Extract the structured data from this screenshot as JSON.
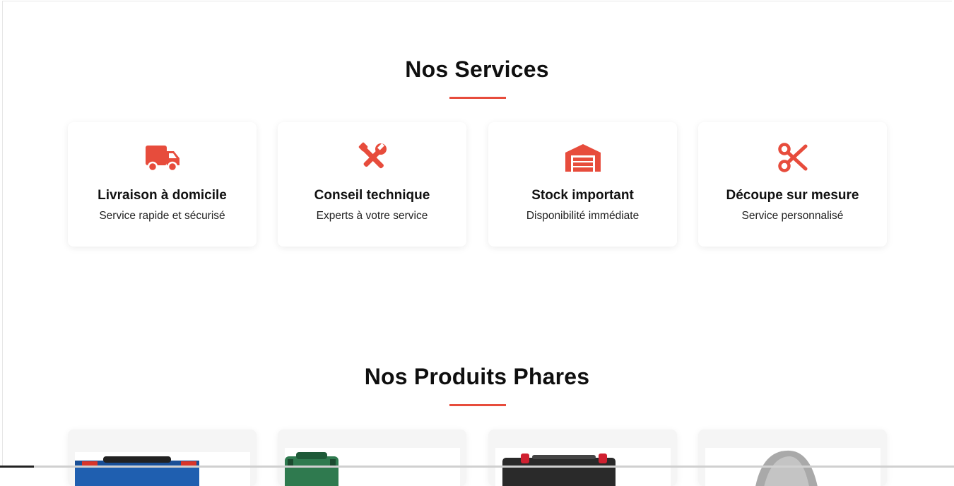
{
  "services_section": {
    "title": "Nos Services",
    "accent_color": "#e74c3c",
    "cards": [
      {
        "icon": "truck-icon",
        "title": "Livraison à domicile",
        "description": "Service rapide et sécurisé"
      },
      {
        "icon": "tools-icon",
        "title": "Conseil technique",
        "description": "Experts à votre service"
      },
      {
        "icon": "warehouse-icon",
        "title": "Stock important",
        "description": "Disponibilité immédiate"
      },
      {
        "icon": "scissors-icon",
        "title": "Découpe sur mesure",
        "description": "Service personnalisé"
      }
    ]
  },
  "products_section": {
    "title": "Nos Produits Phares",
    "cards": [
      {
        "image": "blue-tool-case-image"
      },
      {
        "image": "green-tool-case-image"
      },
      {
        "image": "red-black-tool-image"
      },
      {
        "image": "grey-circular-saw-image"
      }
    ]
  }
}
